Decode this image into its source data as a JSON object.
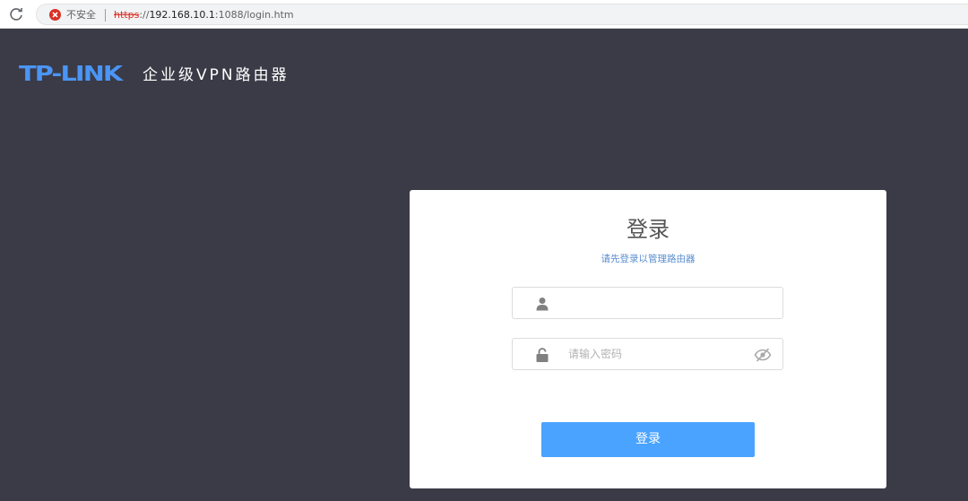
{
  "browser": {
    "security_label": "不安全",
    "url_scheme": "https",
    "url_sep": "://",
    "url_host": "192.168.10.1",
    "url_path": ":1088/login.htm"
  },
  "brand": {
    "logo": "TP-LINK",
    "product": "企业级VPN路由器"
  },
  "login": {
    "title": "登录",
    "subtitle": "请先登录以管理路由器",
    "username_value": "",
    "password_placeholder": "请输入密码",
    "submit_label": "登录"
  },
  "colors": {
    "background": "#3b3b47",
    "accent": "#4aa3ff",
    "logo": "#4a95f5",
    "warning": "#d93025"
  },
  "icons": {
    "reload": "reload-icon",
    "warning": "not-secure-warning-icon",
    "user": "user-icon",
    "lock": "lock-icon",
    "eye": "eye-hidden-icon"
  }
}
